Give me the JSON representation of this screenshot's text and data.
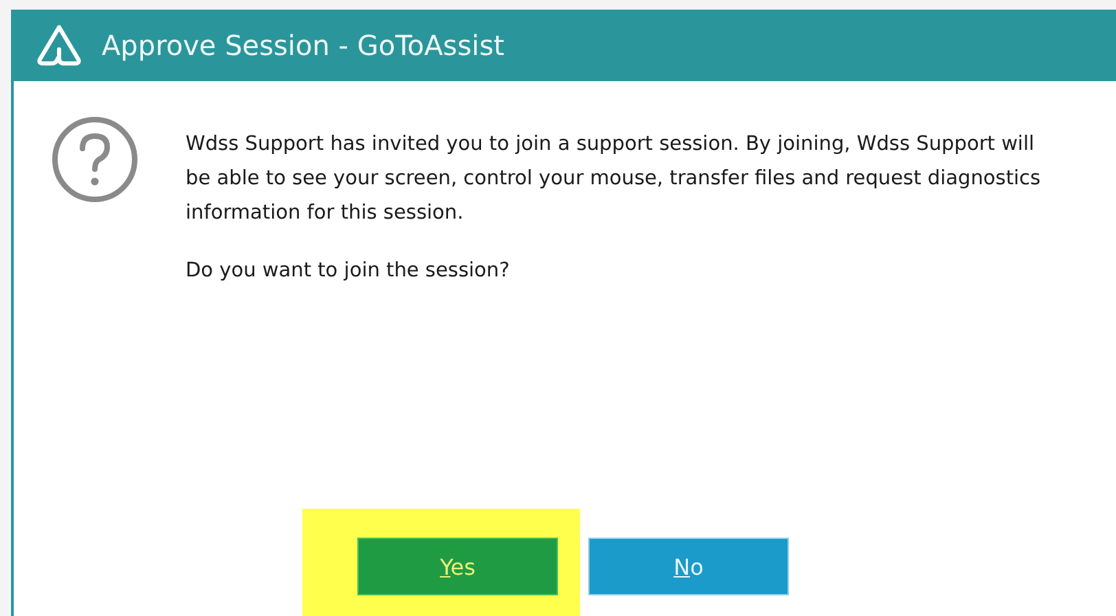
{
  "window": {
    "title": "Approve Session - GoToAssist"
  },
  "message": {
    "paragraphs": [
      "Wdss Support has invited you to join a support session. By joining, Wdss Support will be able to see your screen, control your mouse, transfer files and request diagnostics information for this session.",
      "Do you want to join the session?"
    ]
  },
  "buttons": [
    {
      "label": "Yes",
      "kind": "confirm",
      "highlighted": true
    },
    {
      "label": "No",
      "kind": "cancel",
      "highlighted": false
    }
  ]
}
